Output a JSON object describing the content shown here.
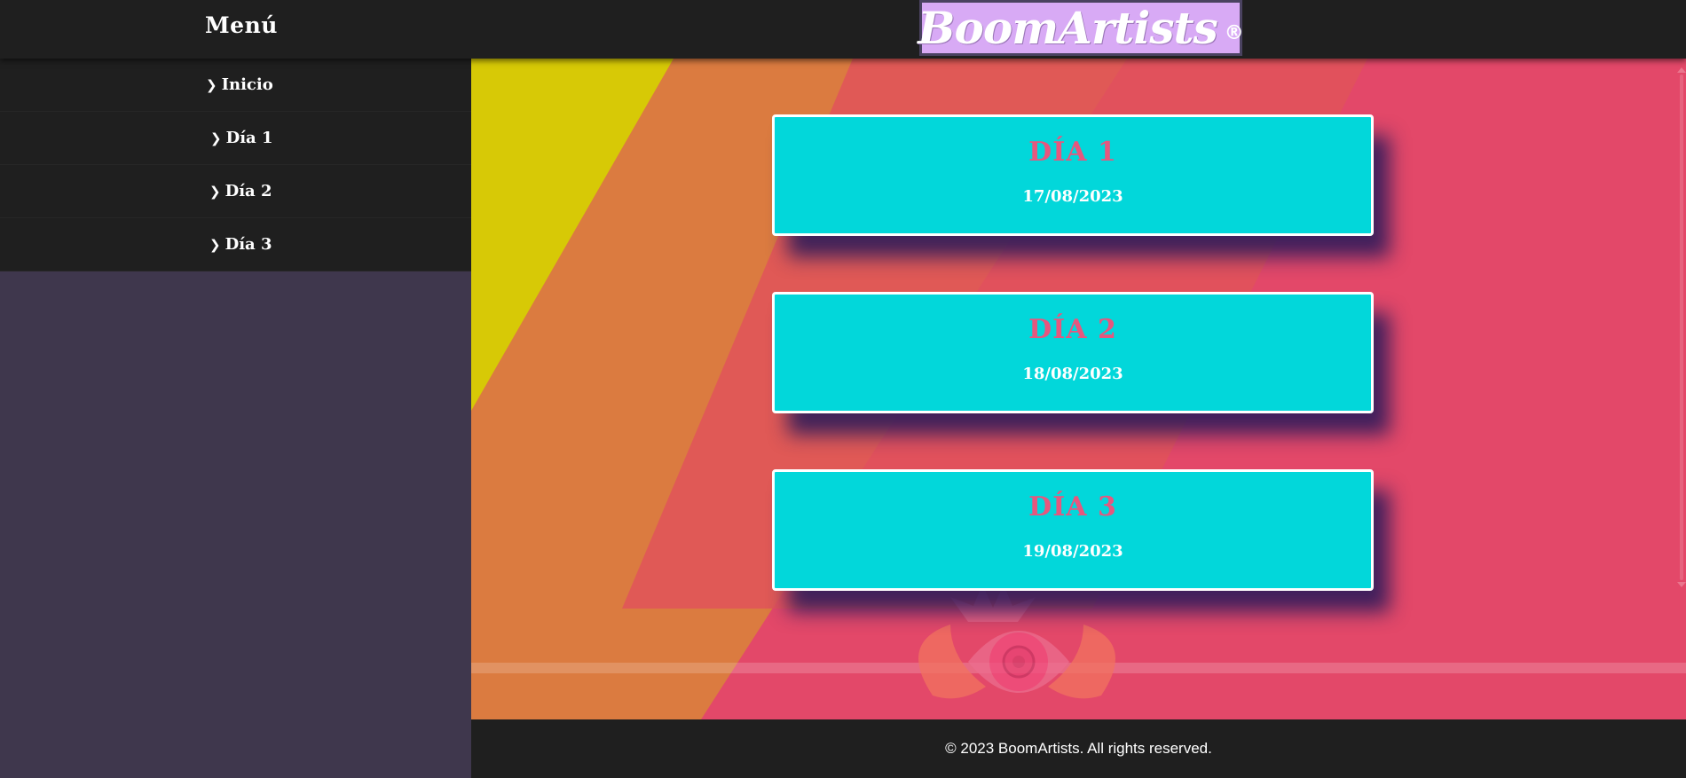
{
  "header": {
    "menu_title": "Menú",
    "logo_text": "BoomArtists",
    "logo_mark": "®"
  },
  "sidebar": {
    "items": [
      {
        "label": "Inicio"
      },
      {
        "label": "Día 1"
      },
      {
        "label": "Día 2"
      },
      {
        "label": "Día 3"
      }
    ]
  },
  "cards": [
    {
      "title": "DÍA 1",
      "date": "17/08/2023"
    },
    {
      "title": "DÍA 2",
      "date": "18/08/2023"
    },
    {
      "title": "DÍA 3",
      "date": "19/08/2023"
    }
  ],
  "footer": {
    "text": "© 2023 BoomArtists. All rights reserved."
  },
  "colors": {
    "header_bg": "#1f1f1f",
    "sidebar_bg": "#3f374d",
    "logo_bg": "#d8aaf5",
    "card_bg": "#02d7da",
    "card_title": "#e6577e",
    "stripe_yellow": "#d7c906",
    "stripe_orange": "#db7b40",
    "stripe_pink": "#e34869"
  },
  "icons": [
    "chevron-right-icon",
    "eye-emblem-icon"
  ]
}
